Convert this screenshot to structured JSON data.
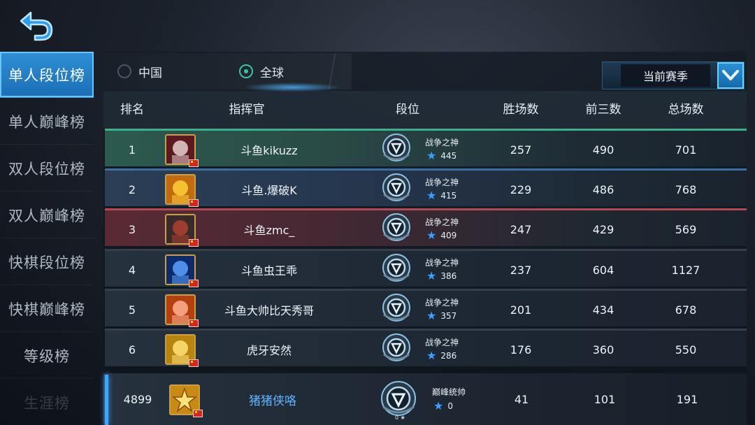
{
  "sidebar": {
    "items": [
      {
        "label": "单人段位榜"
      },
      {
        "label": "单人巅峰榜"
      },
      {
        "label": "双人段位榜"
      },
      {
        "label": "双人巅峰榜"
      },
      {
        "label": "快棋段位榜"
      },
      {
        "label": "快棋巅峰榜"
      },
      {
        "label": "等级榜"
      },
      {
        "label": "生涯榜"
      }
    ]
  },
  "tabs": [
    {
      "label": "中国",
      "selected": false
    },
    {
      "label": "全球",
      "selected": true
    }
  ],
  "season": {
    "label": "当前赛季"
  },
  "table": {
    "headers": [
      "排名",
      "指挥官",
      "段位",
      "胜场数",
      "前三数",
      "总场数"
    ],
    "rows": [
      {
        "rank": "1",
        "name": "斗鱼kikuzz",
        "tier": "战争之神",
        "stars": "445",
        "wins": "257",
        "top3": "490",
        "total": "701"
      },
      {
        "rank": "2",
        "name": "斗鱼.爆破K",
        "tier": "战争之神",
        "stars": "415",
        "wins": "229",
        "top3": "486",
        "total": "768"
      },
      {
        "rank": "3",
        "name": "斗鱼zmc_",
        "tier": "战争之神",
        "stars": "409",
        "wins": "247",
        "top3": "429",
        "total": "569"
      },
      {
        "rank": "4",
        "name": "斗鱼虫王乖",
        "tier": "战争之神",
        "stars": "386",
        "wins": "237",
        "top3": "604",
        "total": "1127"
      },
      {
        "rank": "5",
        "name": "斗鱼大帅比天秀哥",
        "tier": "战争之神",
        "stars": "357",
        "wins": "201",
        "top3": "434",
        "total": "678"
      },
      {
        "rank": "6",
        "name": "虎牙安然",
        "tier": "战争之神",
        "stars": "286",
        "wins": "176",
        "top3": "360",
        "total": "550"
      }
    ],
    "me": {
      "rank": "4899",
      "name": "猪猪侠咯",
      "tier": "巅峰统帅",
      "stars": "0",
      "wins": "41",
      "top3": "101",
      "total": "191"
    }
  },
  "colors": {
    "accent": "#2f8fd6",
    "name_highlight": "#5fb4ff",
    "star": "#3aa0ff"
  }
}
